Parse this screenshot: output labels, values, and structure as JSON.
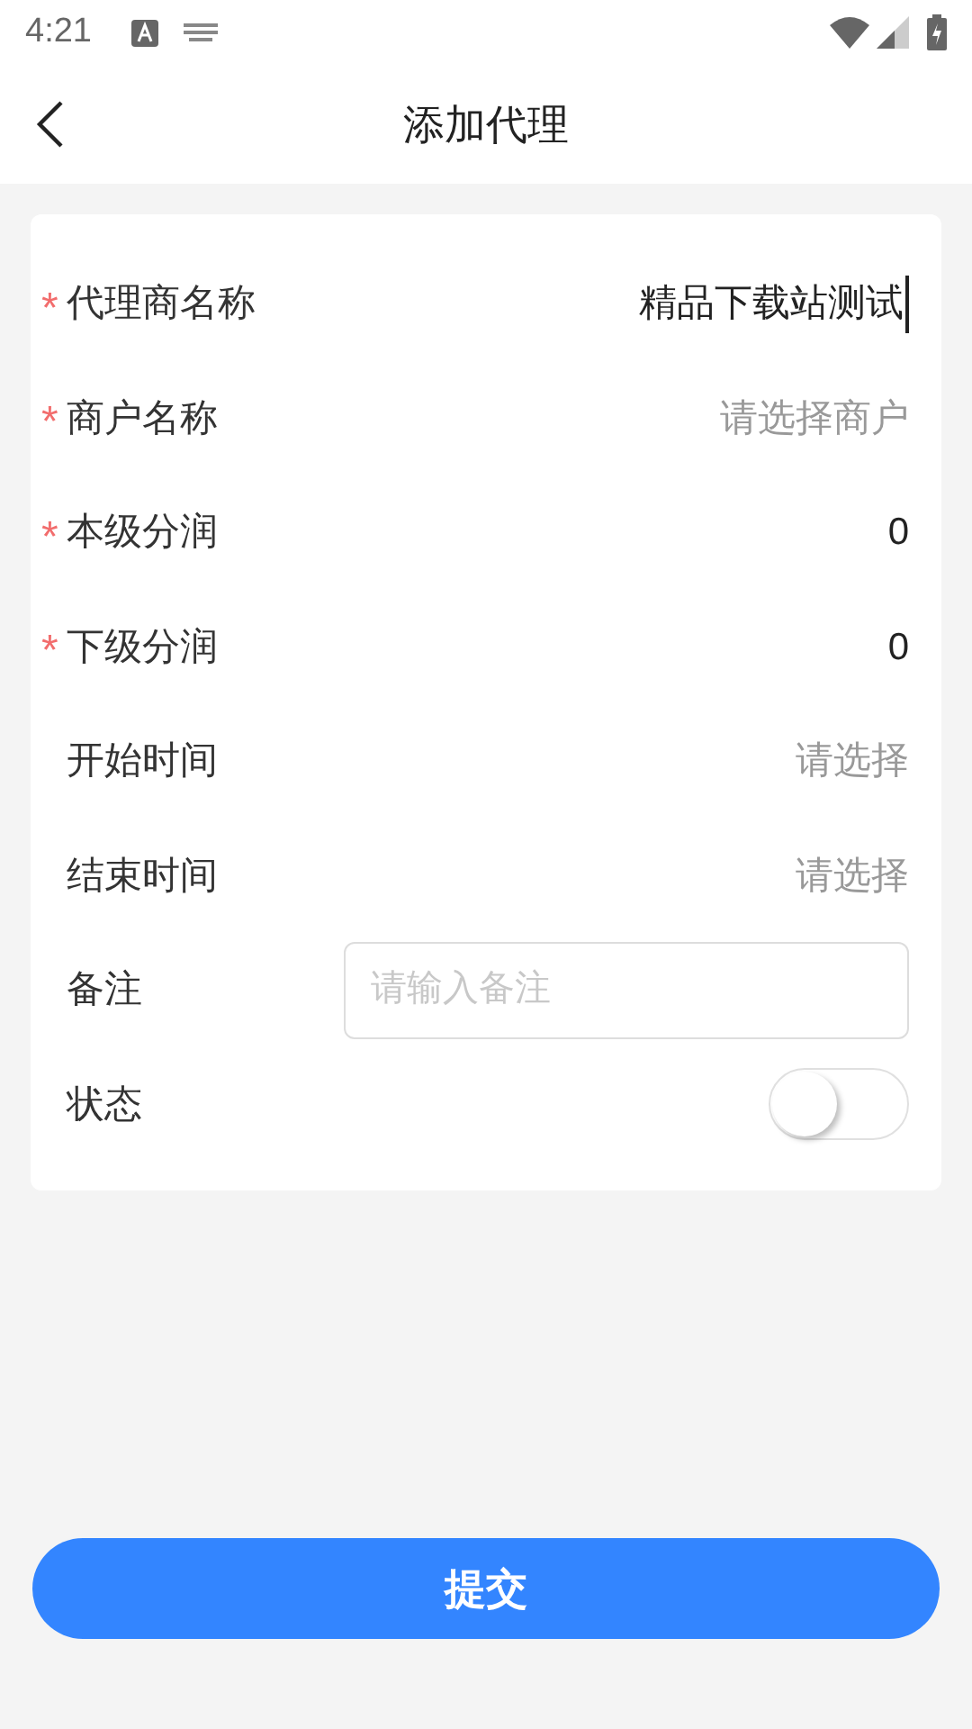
{
  "status_bar": {
    "time": "4:21"
  },
  "header": {
    "title": "添加代理"
  },
  "form": [
    {
      "kind": "text",
      "required_mark": "*",
      "label": "代理商名称",
      "value": "精品下载站测试"
    },
    {
      "kind": "select",
      "required_mark": "*",
      "label": "商户名称",
      "placeholder": "请选择商户"
    },
    {
      "kind": "text",
      "required_mark": "*",
      "label": "本级分润",
      "value": "0"
    },
    {
      "kind": "text",
      "required_mark": "*",
      "label": "下级分润",
      "value": "0"
    },
    {
      "kind": "select",
      "label": "开始时间",
      "placeholder": "请选择"
    },
    {
      "kind": "select",
      "label": "结束时间",
      "placeholder": "请选择"
    },
    {
      "kind": "textarea",
      "label": "备注",
      "placeholder": "请输入备注"
    },
    {
      "kind": "switch",
      "label": "状态",
      "on": false
    }
  ],
  "submit": {
    "label": "提交"
  }
}
